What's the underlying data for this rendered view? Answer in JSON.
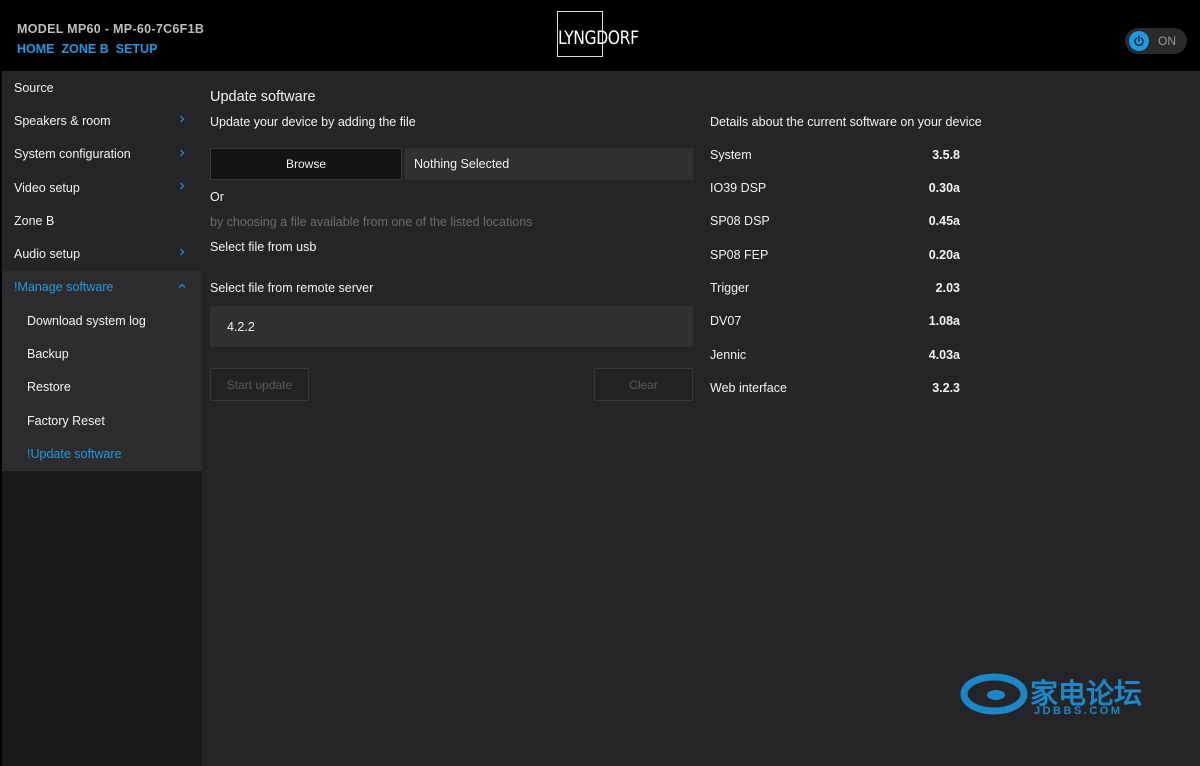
{
  "header": {
    "model": "MODEL MP60 - MP-60-7C6F1B",
    "nav": [
      "HOME",
      "ZONE B",
      "SETUP"
    ],
    "logo_text": "LYNGDORF",
    "power_label": "ON"
  },
  "sidebar": {
    "items": [
      {
        "label": "Source"
      },
      {
        "label": "Speakers & room"
      },
      {
        "label": "System configuration"
      },
      {
        "label": "Video setup"
      },
      {
        "label": "Zone B"
      },
      {
        "label": "Audio setup"
      },
      {
        "label": "!Manage software"
      }
    ],
    "subitems": [
      {
        "label": "Download system log"
      },
      {
        "label": "Backup"
      },
      {
        "label": "Restore"
      },
      {
        "label": "Factory Reset"
      },
      {
        "label": "!Update software"
      }
    ]
  },
  "main": {
    "title": "Update software",
    "subtitle": "Update your device by adding the file",
    "browse_label": "Browse",
    "file_value": "Nothing Selected",
    "or_label": "Or",
    "hint": "by choosing a file available from one of the listed locations",
    "usb_label": "Select file from usb",
    "remote_label": "Select file from remote server",
    "remote_value": "4.2.2",
    "start_label": "Start update",
    "clear_label": "Clear"
  },
  "details": {
    "title": "Details about the current software on your device",
    "rows": [
      {
        "name": "System",
        "version": "3.5.8"
      },
      {
        "name": "IO39 DSP",
        "version": "0.30a"
      },
      {
        "name": "SP08 DSP",
        "version": "0.45a"
      },
      {
        "name": "SP08 FEP",
        "version": "0.20a"
      },
      {
        "name": "Trigger",
        "version": "2.03"
      },
      {
        "name": "DV07",
        "version": "1.08a"
      },
      {
        "name": "Jennic",
        "version": "4.03a"
      },
      {
        "name": "Web interface",
        "version": "3.2.3"
      }
    ]
  },
  "watermark": {
    "cn": "家电论坛",
    "en": "JDBBS.COM"
  },
  "colors": {
    "accent": "#1e9be0",
    "background": "#252527",
    "header": "#000000"
  }
}
